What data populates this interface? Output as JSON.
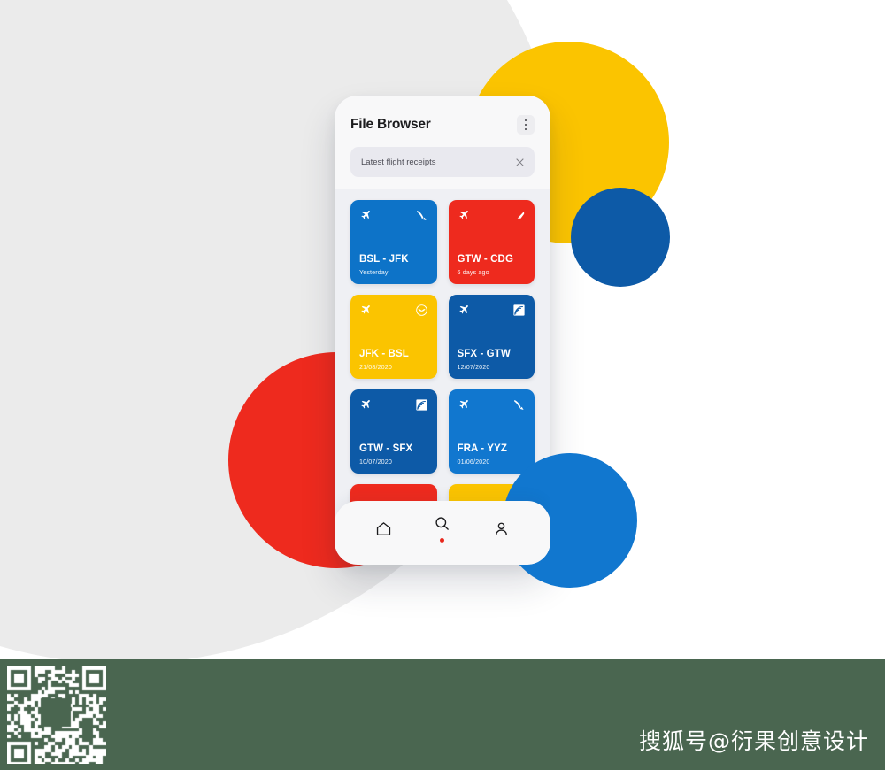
{
  "app": {
    "title": "File Browser",
    "menu_icon": "kebab-menu-icon"
  },
  "search": {
    "value": "Latest flight receipts",
    "clear_icon": "close-icon"
  },
  "cards": [
    {
      "route": "BSL - JFK",
      "date": "Yesterday",
      "color": "#0d73c8",
      "logo": "swoosh-airline-logo",
      "plane": "plane-icon"
    },
    {
      "route": "GTW - CDG",
      "date": "6 days ago",
      "color": "#ee2a1e",
      "logo": "wing-airline-logo",
      "plane": "plane-icon"
    },
    {
      "route": "JFK - BSL",
      "date": "21/08/2020",
      "color": "#fbc400",
      "logo": "crane-airline-logo",
      "plane": "plane-icon"
    },
    {
      "route": "SFX - GTW",
      "date": "12/07/2020",
      "color": "#0d5aa7",
      "logo": "striped-airline-logo",
      "plane": "plane-icon"
    },
    {
      "route": "GTW - SFX",
      "date": "10/07/2020",
      "color": "#0d5aa7",
      "logo": "striped-airline-logo",
      "plane": "plane-icon"
    },
    {
      "route": "FRA - YYZ",
      "date": "01/06/2020",
      "color": "#1177cf",
      "logo": "swoosh-airline-logo",
      "plane": "plane-icon"
    }
  ],
  "partial_cards": [
    {
      "color": "#ee2a1e"
    },
    {
      "color": "#fbc400"
    }
  ],
  "nav": {
    "items": [
      {
        "icon": "home-icon",
        "active": false
      },
      {
        "icon": "search-icon",
        "active": true
      },
      {
        "icon": "person-icon",
        "active": false
      }
    ],
    "active_dot_color": "#e8271c"
  },
  "background": {
    "shapes": [
      {
        "name": "gray-blob",
        "color": "#ebebeb"
      },
      {
        "name": "yellow-circle",
        "color": "#fbc400"
      },
      {
        "name": "navy-circle",
        "color": "#0d5aa7"
      },
      {
        "name": "red-circle",
        "color": "#ee2a1e"
      },
      {
        "name": "blue-circle",
        "color": "#1177cf"
      }
    ]
  },
  "watermark": {
    "text": "搜狐号@衍果创意设计",
    "bar_color": "#4a6650",
    "qr_label": "qr-code"
  }
}
